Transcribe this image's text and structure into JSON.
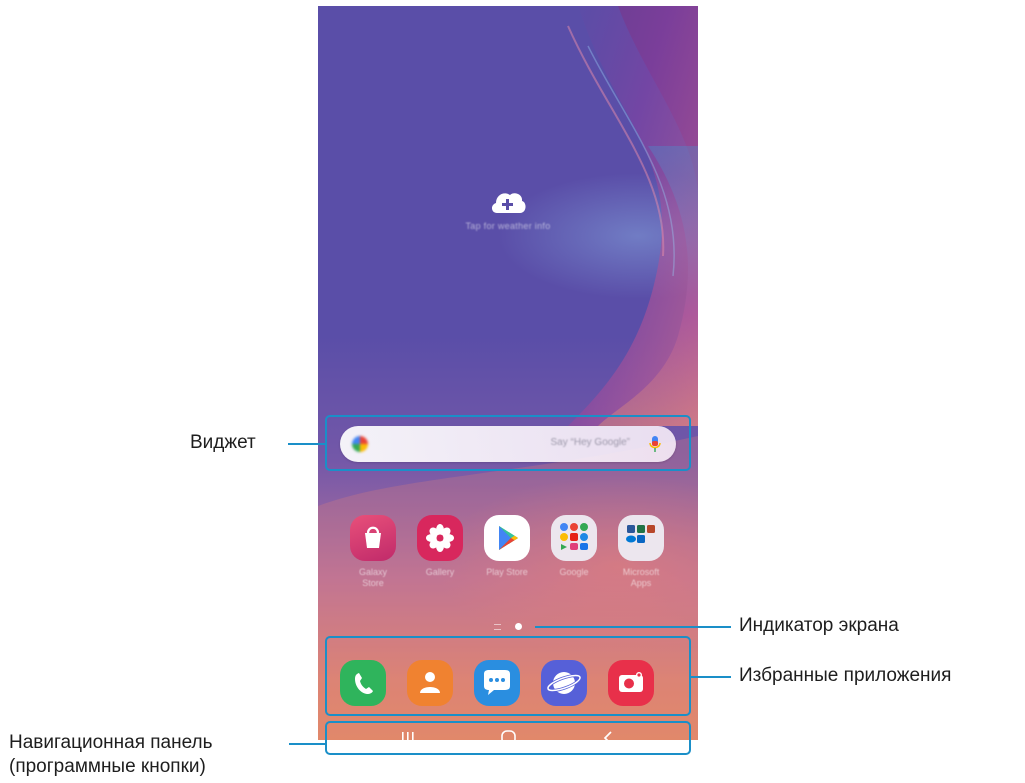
{
  "callouts": {
    "widget": "Виджет",
    "screen_indicator": "Индикатор экрана",
    "favorite_apps": "Избранные приложения",
    "nav_panel_line1": "Навигационная панель",
    "nav_panel_line2": "(программные кнопки)"
  },
  "weather_widget": {
    "icon": "cloud-plus-icon",
    "text": "Tap for weather info"
  },
  "search_widget": {
    "hint": "Say “Hey Google”",
    "icons": [
      "google-logo-icon",
      "mic-icon"
    ]
  },
  "apps": [
    {
      "label_line1": "Galaxy",
      "label_line2": "Store",
      "icon": "shopping-bag-icon",
      "color": "#d63b7a"
    },
    {
      "label_line1": "Gallery",
      "label_line2": "",
      "icon": "flower-icon",
      "color": "#d8275d"
    },
    {
      "label_line1": "Play Store",
      "label_line2": "",
      "icon": "play-store-icon",
      "color": "#ffffff"
    },
    {
      "label_line1": "Google",
      "label_line2": "",
      "icon": "folder-icon",
      "color": "#ece6ee"
    },
    {
      "label_line1": "Microsoft",
      "label_line2": "Apps",
      "icon": "folder-icon",
      "color": "#ece6ee"
    }
  ],
  "dock": [
    {
      "icon": "phone-icon",
      "color": "#2fb45c"
    },
    {
      "icon": "contacts-icon",
      "color": "#f08230"
    },
    {
      "icon": "messages-icon",
      "color": "#2a8ee0"
    },
    {
      "icon": "internet-icon",
      "color": "#5660d8"
    },
    {
      "icon": "camera-icon",
      "color": "#e8304a"
    }
  ],
  "nav_buttons": [
    {
      "icon": "recents-icon",
      "glyph": "|||"
    },
    {
      "icon": "home-icon",
      "glyph": "○"
    },
    {
      "icon": "back-icon",
      "glyph": "‹"
    }
  ],
  "colors": {
    "callout_line": "#1a8fc8",
    "wallpaper_top": "#5a4ea8",
    "wallpaper_bottom": "#df8a66"
  }
}
